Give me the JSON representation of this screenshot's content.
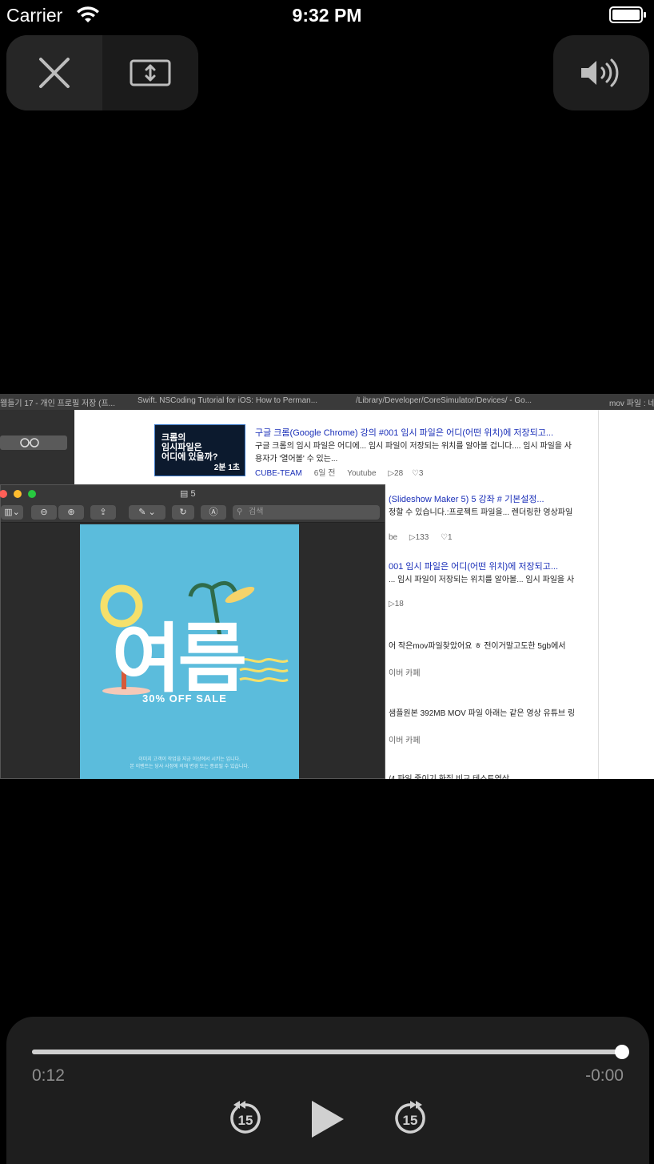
{
  "status_bar": {
    "carrier": "Carrier",
    "time": "9:32 PM"
  },
  "top_controls": {
    "close_icon": "close-icon",
    "resize_icon": "resize-vertical-icon",
    "volume_icon": "volume-icon"
  },
  "video": {
    "tabs": [
      "웹들기 17 - 개인 프로필 저장 (프...",
      "Swift. NSCoding Tutorial for iOS: How to Perman...",
      "/Library/Developer/CoreSimulator/Devices/ - Go...",
      "mov 파일 : 네"
    ],
    "thumbnail": {
      "title": "크롬의\n임시파일은\n어디에 있을까?",
      "duration": "2분 1초"
    },
    "results": [
      {
        "title": "구글 크롬(Google Chrome) 강의 #001 임시 파일은 어디(어떤 위치)에 저장되고...",
        "line1": "구글 크롬의 임시 파일은 어디에... 임시 파일이 저장되는 위치를 알아볼 겁니다.... 임시 파일을 사",
        "line2": "용자가 '열어볼' 수 있는...",
        "source": "CUBE-TEAM",
        "age": "6일 전",
        "site": "Youtube",
        "plays": "▷28",
        "likes": "♡3"
      },
      {
        "title": "(Slideshow Maker 5) 5 강좌 # 기본설정...",
        "line1": "정할 수 있습니다.:프로젝트 파일을... 렌더링한 영상파일",
        "meta": "be",
        "plays": "▷133",
        "likes": "♡1"
      },
      {
        "title": "001 임시 파일은 어디(어떤 위치)에 저장되고...",
        "line1": "... 임시 파일이 저장되는 위치를 알아볼... 임시 파일을 사",
        "plays": "▷18"
      },
      {
        "line1": "어 작은mov파일찾았어요 ㅎ 전이거말고도한 5gb에서",
        "meta": "이버 카페"
      },
      {
        "line1": "샘플원본 392MB MOV 파일 아래는 같은 영상 유튜브 링",
        "meta": "이버 카페"
      },
      {
        "line1": "/4 파일 줄이기 화질 비교 테스트영상"
      }
    ],
    "preview": {
      "file_name": "5",
      "search_placeholder": "검색",
      "poster_big": "여름",
      "poster_sale": "30% OFF SALE",
      "poster_fine": "이미지 고객이 작업을 지금 이상에서 시키는 입니다.\n본 이벤트는 당사 사정에 의해 변경 또는 종료될 수 있습니다."
    }
  },
  "player": {
    "elapsed": "0:12",
    "remaining": "-0:00",
    "progress": 1.0,
    "skip_back_seconds": "15",
    "skip_forward_seconds": "15",
    "play_icon": "play-icon"
  }
}
